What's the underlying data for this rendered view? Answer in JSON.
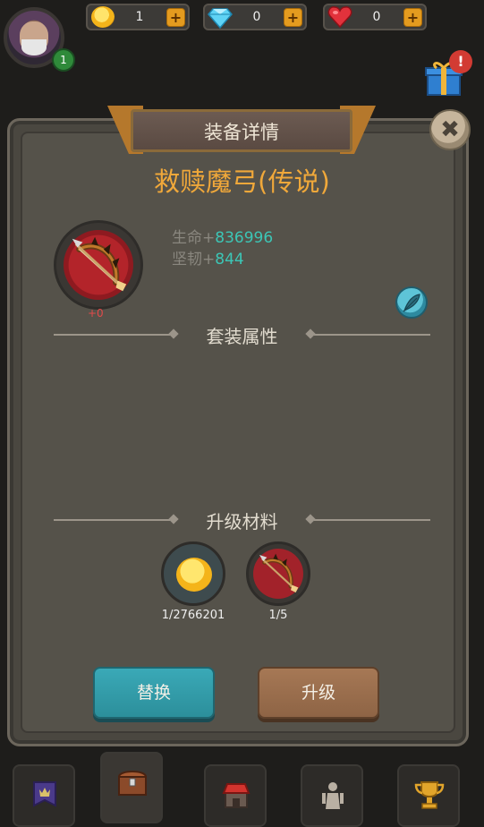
{
  "top_bar": {
    "level": "1",
    "coins": "1",
    "gems": "0",
    "hearts": "0",
    "plus_label": "+",
    "gift_alert": "!"
  },
  "dialog": {
    "title": "装备详情",
    "close_label": "✖",
    "item_name": "救赎魔弓(传说)",
    "item_level": "+0",
    "stats": [
      {
        "label": "生命+",
        "value": "836996"
      },
      {
        "label": "坚韧+",
        "value": "844"
      }
    ],
    "set_section": "套装属性",
    "materials_section": "升级材料",
    "materials": [
      {
        "icon": "gold-coin-icon",
        "count": "1/2766201"
      },
      {
        "icon": "bow-icon",
        "count": "1/5"
      }
    ],
    "replace_button": "替换",
    "upgrade_button": "升级"
  },
  "bottom_nav": {
    "tabs": [
      "banner-icon",
      "chest-icon",
      "shop-icon",
      "hero-icon",
      "trophy-icon"
    ]
  },
  "colors": {
    "item_name": "#f0a83a",
    "stat_value": "#3cc6b6",
    "replace_button": "#3aa9b7",
    "upgrade_button": "#a67855"
  }
}
